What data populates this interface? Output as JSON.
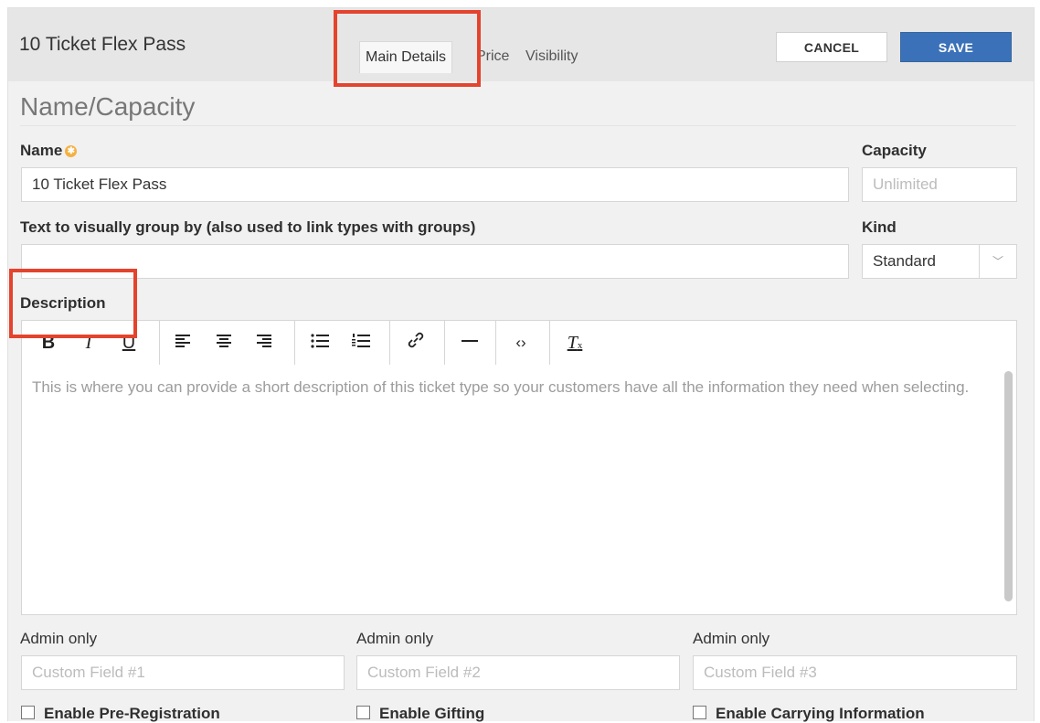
{
  "header": {
    "title": "10 Ticket Flex Pass",
    "tabs": [
      {
        "label": "Main Details",
        "active": true
      },
      {
        "label": "Price",
        "active": false
      },
      {
        "label": "Visibility",
        "active": false
      }
    ],
    "cancel_label": "CANCEL",
    "save_label": "SAVE"
  },
  "section": {
    "title": "Name/Capacity"
  },
  "fields": {
    "name_label": "Name",
    "name_value": "10 Ticket Flex Pass",
    "capacity_label": "Capacity",
    "capacity_placeholder": "Unlimited",
    "group_label": "Text to visually group by (also used to link types with groups)",
    "group_value": "",
    "kind_label": "Kind",
    "kind_value": "Standard",
    "description_label": "Description"
  },
  "editor": {
    "toolbar_icons": [
      "bold-icon",
      "italic-icon",
      "underline-icon",
      "align-left-icon",
      "align-center-icon",
      "align-right-icon",
      "bullet-list-icon",
      "numbered-list-icon",
      "link-icon",
      "horizontal-rule-icon",
      "code-icon",
      "clear-format-icon"
    ],
    "placeholder": "This is where you can provide a short description of this ticket type so your customers have all the information they need when selecting."
  },
  "custom_fields": [
    {
      "label": "Admin only",
      "placeholder": "Custom Field #1"
    },
    {
      "label": "Admin only",
      "placeholder": "Custom Field #2"
    },
    {
      "label": "Admin only",
      "placeholder": "Custom Field #3"
    }
  ],
  "checkboxes": [
    {
      "label": "Enable Pre-Registration"
    },
    {
      "label": "Enable Gifting"
    },
    {
      "label": "Enable Carrying Information"
    }
  ],
  "colors": {
    "accent": "#3b71b8",
    "annotation": "#e4432d",
    "required": "#f5b041"
  }
}
